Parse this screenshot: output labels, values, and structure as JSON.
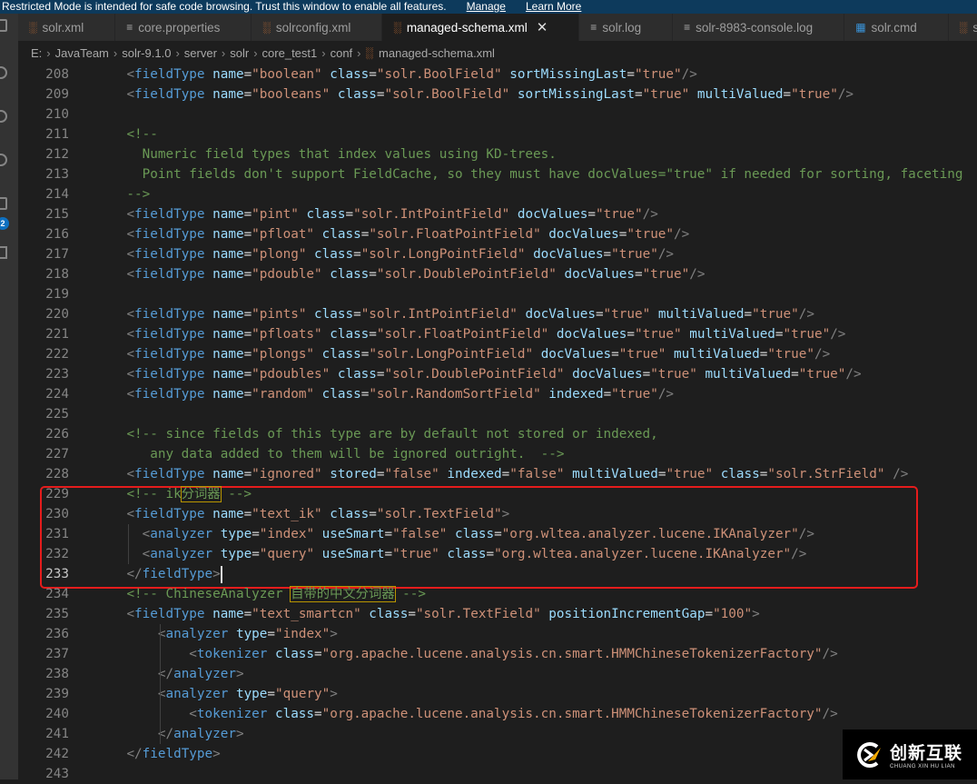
{
  "banner": {
    "text": "Restricted Mode is intended for safe code browsing. Trust this window to enable all features.",
    "manage": "Manage",
    "learn_more": "Learn More"
  },
  "activity_badge": "2",
  "tabs": [
    {
      "label": "solr.xml",
      "icon": "rss-xml-icon"
    },
    {
      "label": "core.properties",
      "icon": "lines-file-icon"
    },
    {
      "label": "solrconfig.xml",
      "icon": "rss-xml-icon"
    },
    {
      "label": "managed-schema.xml",
      "icon": "rss-xml-icon",
      "active": true
    },
    {
      "label": "solr.log",
      "icon": "lines-file-icon"
    },
    {
      "label": "solr-8983-console.log",
      "icon": "lines-file-icon"
    },
    {
      "label": "solr.cmd",
      "icon": "windows-icon"
    },
    {
      "label": "s",
      "icon": "rss-xml-icon"
    }
  ],
  "breadcrumb": [
    "E:",
    "JavaTeam",
    "solr-9.1.0",
    "server",
    "solr",
    "core_test1",
    "conf",
    "managed-schema.xml"
  ],
  "editor": {
    "current_line": 233,
    "lines": [
      {
        "n": 208,
        "text": "    <fieldType name=\"boolean\" class=\"solr.BoolField\" sortMissingLast=\"true\"/>"
      },
      {
        "n": 209,
        "text": "    <fieldType name=\"booleans\" class=\"solr.BoolField\" sortMissingLast=\"true\" multiValued=\"true\"/>"
      },
      {
        "n": 210,
        "text": ""
      },
      {
        "n": 211,
        "text": "    <!--"
      },
      {
        "n": 212,
        "text": "      Numeric field types that index values using KD-trees."
      },
      {
        "n": 213,
        "text": "      Point fields don't support FieldCache, so they must have docValues=\"true\" if needed for sorting, faceting"
      },
      {
        "n": 214,
        "text": "    -->"
      },
      {
        "n": 215,
        "text": "    <fieldType name=\"pint\" class=\"solr.IntPointField\" docValues=\"true\"/>"
      },
      {
        "n": 216,
        "text": "    <fieldType name=\"pfloat\" class=\"solr.FloatPointField\" docValues=\"true\"/>"
      },
      {
        "n": 217,
        "text": "    <fieldType name=\"plong\" class=\"solr.LongPointField\" docValues=\"true\"/>"
      },
      {
        "n": 218,
        "text": "    <fieldType name=\"pdouble\" class=\"solr.DoublePointField\" docValues=\"true\"/>"
      },
      {
        "n": 219,
        "text": ""
      },
      {
        "n": 220,
        "text": "    <fieldType name=\"pints\" class=\"solr.IntPointField\" docValues=\"true\" multiValued=\"true\"/>"
      },
      {
        "n": 221,
        "text": "    <fieldType name=\"pfloats\" class=\"solr.FloatPointField\" docValues=\"true\" multiValued=\"true\"/>"
      },
      {
        "n": 222,
        "text": "    <fieldType name=\"plongs\" class=\"solr.LongPointField\" docValues=\"true\" multiValued=\"true\"/>"
      },
      {
        "n": 223,
        "text": "    <fieldType name=\"pdoubles\" class=\"solr.DoublePointField\" docValues=\"true\" multiValued=\"true\"/>"
      },
      {
        "n": 224,
        "text": "    <fieldType name=\"random\" class=\"solr.RandomSortField\" indexed=\"true\"/>"
      },
      {
        "n": 225,
        "text": ""
      },
      {
        "n": 226,
        "text": "    <!-- since fields of this type are by default not stored or indexed,"
      },
      {
        "n": 227,
        "text": "       any data added to them will be ignored outright.  -->"
      },
      {
        "n": 228,
        "text": "    <fieldType name=\"ignored\" stored=\"false\" indexed=\"false\" multiValued=\"true\" class=\"solr.StrField\" />"
      },
      {
        "n": 229,
        "text": "    <!-- ik分词器 -->"
      },
      {
        "n": 230,
        "text": "    <fieldType name=\"text_ik\" class=\"solr.TextField\">"
      },
      {
        "n": 231,
        "text": "      <analyzer type=\"index\" useSmart=\"false\" class=\"org.wltea.analyzer.lucene.IKAnalyzer\"/>"
      },
      {
        "n": 232,
        "text": "      <analyzer type=\"query\" useSmart=\"true\" class=\"org.wltea.analyzer.lucene.IKAnalyzer\"/>"
      },
      {
        "n": 233,
        "text": "    </fieldType>"
      },
      {
        "n": 234,
        "text": "    <!-- ChineseAnalyzer 自带的中文分词器 -->"
      },
      {
        "n": 235,
        "text": "    <fieldType name=\"text_smartcn\" class=\"solr.TextField\" positionIncrementGap=\"100\">"
      },
      {
        "n": 236,
        "text": "        <analyzer type=\"index\">"
      },
      {
        "n": 237,
        "text": "            <tokenizer class=\"org.apache.lucene.analysis.cn.smart.HMMChineseTokenizerFactory\"/>"
      },
      {
        "n": 238,
        "text": "        </analyzer>"
      },
      {
        "n": 239,
        "text": "        <analyzer type=\"query\">"
      },
      {
        "n": 240,
        "text": "            <tokenizer class=\"org.apache.lucene.analysis.cn.smart.HMMChineseTokenizerFactory\"/>"
      },
      {
        "n": 241,
        "text": "        </analyzer>"
      },
      {
        "n": 242,
        "text": "    </fieldType>"
      },
      {
        "n": 243,
        "text": ""
      }
    ]
  },
  "highlight_color": "#e51c1c",
  "watermark": {
    "cn": "创新互联",
    "en": "CHUANG XIN HU LIAN"
  }
}
